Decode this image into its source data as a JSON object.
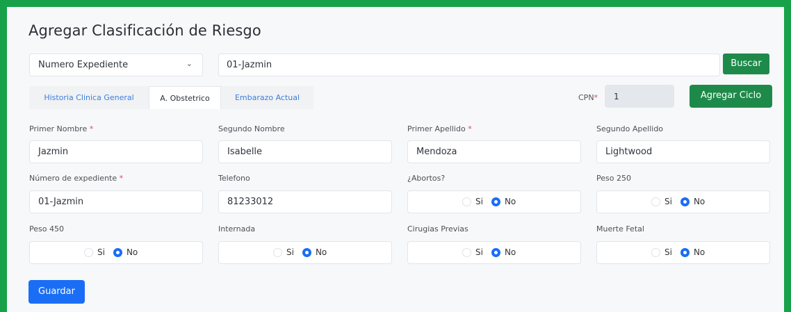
{
  "page": {
    "title": "Agregar Clasificación de Riesgo"
  },
  "search": {
    "filter_value": "Numero Expediente",
    "query_value": "01-Jazmin",
    "search_label": "Buscar"
  },
  "tabs": [
    {
      "label": "Historia Clinica General",
      "active": false
    },
    {
      "label": "A. Obstetrico",
      "active": true
    },
    {
      "label": "Embarazo Actual",
      "active": false
    }
  ],
  "cpn": {
    "label": "CPN",
    "required_mark": "*",
    "value": "1"
  },
  "actions": {
    "add_cycle_label": "Agregar Ciclo",
    "save_label": "Guardar"
  },
  "form": {
    "primer_nombre": {
      "label": "Primer Nombre",
      "required": "*",
      "value": "Jazmin"
    },
    "segundo_nombre": {
      "label": "Segundo Nombre",
      "value": "Isabelle"
    },
    "primer_apellido": {
      "label": "Primer Apellido",
      "required": "*",
      "value": "Mendoza"
    },
    "segundo_apellido": {
      "label": "Segundo Apellido",
      "value": "Lightwood"
    },
    "numero_expediente": {
      "label": "Número de expediente",
      "required": "*",
      "value": "01-Jazmin"
    },
    "telefono": {
      "label": "Telefono",
      "value": "81233012"
    },
    "abortos": {
      "label": "¿Abortos?",
      "yes": "Si",
      "no": "No",
      "selected": "No"
    },
    "peso_250": {
      "label": "Peso 250",
      "yes": "Si",
      "no": "No",
      "selected": "No"
    },
    "peso_450": {
      "label": "Peso 450",
      "yes": "Si",
      "no": "No",
      "selected": "No"
    },
    "internada": {
      "label": "Internada",
      "yes": "Si",
      "no": "No",
      "selected": "No"
    },
    "cirugias_previas": {
      "label": "Cirugias Previas",
      "yes": "Si",
      "no": "No",
      "selected": "No"
    },
    "muerte_fetal": {
      "label": "Muerte Fetal",
      "yes": "Si",
      "no": "No",
      "selected": "No"
    }
  },
  "colors": {
    "frame": "#17a24a",
    "success": "#1e8a4a",
    "primary": "#1a6ef5",
    "required": "#e0475a"
  }
}
